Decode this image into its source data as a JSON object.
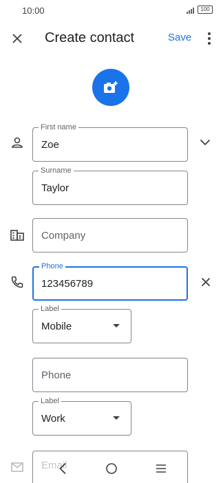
{
  "status_bar": {
    "time": "10:00",
    "battery": "100"
  },
  "app_bar": {
    "title": "Create contact",
    "save_label": "Save"
  },
  "form": {
    "first_name": {
      "label": "First name",
      "value": "Zoe"
    },
    "surname": {
      "label": "Surname",
      "value": "Taylor"
    },
    "company": {
      "placeholder": "Company"
    },
    "phone": {
      "label": "Phone",
      "value": "123456789"
    },
    "phone_label": {
      "label": "Label",
      "value": "Mobile"
    },
    "phone2": {
      "placeholder": "Phone"
    },
    "phone2_label": {
      "label": "Label",
      "value": "Work"
    },
    "email": {
      "placeholder": "Email"
    }
  },
  "icons": {
    "close": "close-icon",
    "more": "more-vert-icon",
    "add_photo": "add-photo-icon",
    "person": "person-icon",
    "expand": "chevron-down-icon",
    "company": "business-icon",
    "phone": "phone-icon",
    "clear": "clear-icon",
    "email": "email-icon"
  },
  "colors": {
    "accent": "#1a73e8",
    "outline": "#80868b",
    "text": "#202124"
  }
}
